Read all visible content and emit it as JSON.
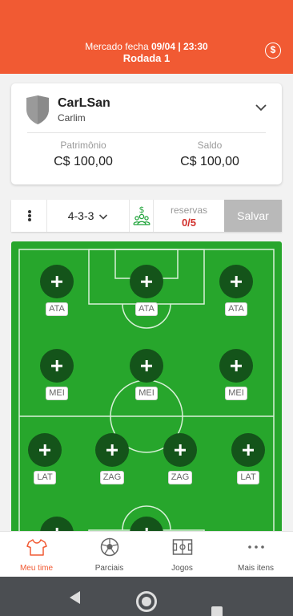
{
  "header": {
    "market_prefix": "Mercado fecha",
    "market_date": "09/04 | 23:30",
    "round": "Rodada 1",
    "coin_symbol": "$"
  },
  "team": {
    "name": "CarLSan",
    "owner": "Carlim",
    "patrimonio_label": "Patrimônio",
    "patrimonio_value": "C$ 100,00",
    "saldo_label": "Saldo",
    "saldo_value": "C$ 100,00"
  },
  "toolbar": {
    "formation": "4-3-3",
    "reserves_label": "reservas",
    "reserves_value": "0/5",
    "save_label": "Salvar"
  },
  "field": {
    "positions": {
      "ata_1": "ATA",
      "ata_2": "ATA",
      "ata_3": "ATA",
      "mei_1": "MEI",
      "mei_2": "MEI",
      "mei_3": "MEI",
      "lat_1": "LAT",
      "zag_1": "ZAG",
      "zag_2": "ZAG",
      "lat_2": "LAT"
    }
  },
  "nav": {
    "items": [
      {
        "label": "Meu time",
        "icon": "shirt-icon",
        "active": true
      },
      {
        "label": "Parciais",
        "icon": "ball-icon",
        "active": false
      },
      {
        "label": "Jogos",
        "icon": "pitch-icon",
        "active": false
      },
      {
        "label": "Mais itens",
        "icon": "more-icon",
        "active": false
      }
    ]
  },
  "colors": {
    "brand": "#f15a33",
    "pitch": "#27a62c",
    "slot": "#14541a",
    "reserves": "#d1302c"
  }
}
